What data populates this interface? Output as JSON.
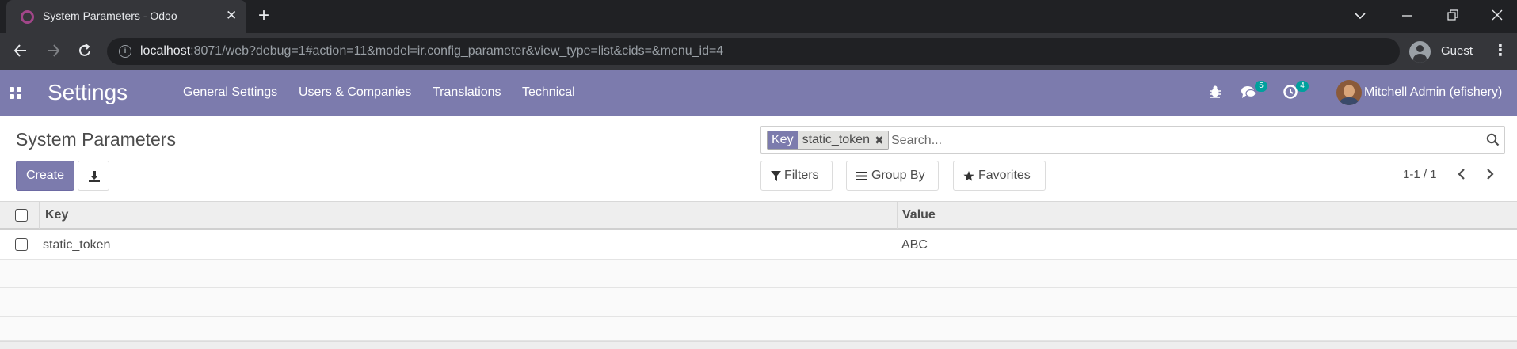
{
  "browser": {
    "tab_title": "System Parameters - Odoo",
    "url_host": "localhost",
    "url_rest": ":8071/web?debug=1#action=11&model=ir.config_parameter&view_type=list&cids=&menu_id=4",
    "profile_name": "Guest",
    "icons": [
      "odoo-favicon",
      "close-icon",
      "plus-icon",
      "chevron-down-icon",
      "minimize-icon",
      "restore-icon",
      "window-close-icon",
      "back-arrow-icon",
      "forward-arrow-icon",
      "reload-icon",
      "info-icon",
      "profile-icon",
      "kebab-menu-icon"
    ]
  },
  "navbar": {
    "brand": "Settings",
    "menu": [
      "General Settings",
      "Users & Companies",
      "Translations",
      "Technical"
    ],
    "messages_count": "5",
    "activities_count": "4",
    "user_name": "Mitchell Admin (efishery)",
    "color": "#7c7bad"
  },
  "control_panel": {
    "title": "System Parameters",
    "create_label": "Create",
    "search": {
      "facet_key": "Key",
      "facet_value": "static_token",
      "placeholder": "Search..."
    },
    "filters_label": "Filters",
    "group_by_label": "Group By",
    "favorites_label": "Favorites",
    "pager": "1-1 / 1"
  },
  "list": {
    "columns": [
      "Key",
      "Value"
    ],
    "rows": [
      {
        "key": "static_token",
        "value": "ABC"
      }
    ]
  }
}
